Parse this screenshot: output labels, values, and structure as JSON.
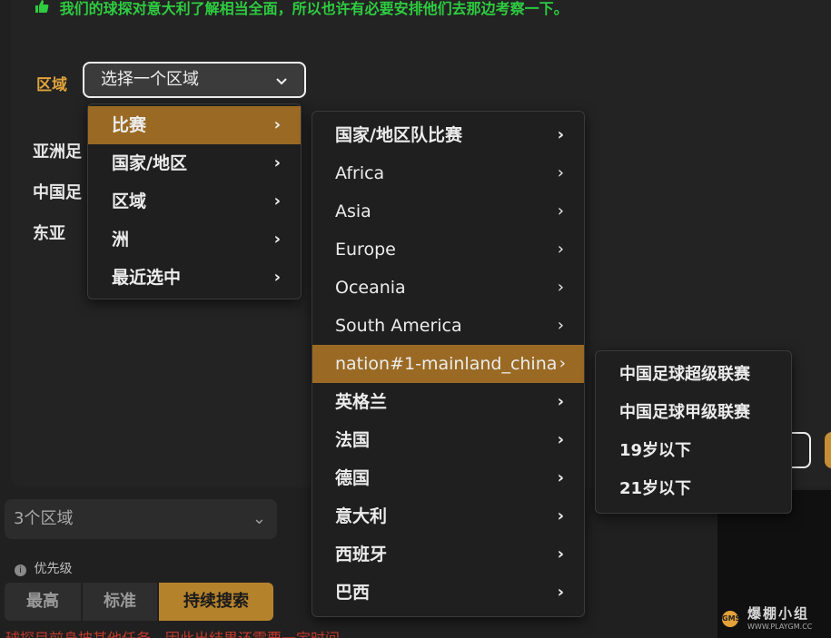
{
  "tip": {
    "icon": "thumbs-up-icon",
    "text": "我们的球探对意大利了解相当全面，所以也许有必要安排他们去那边考察一下。"
  },
  "region": {
    "label": "区域",
    "placeholder": "选择一个区域",
    "selected_items": [
      "亚洲足",
      "中国足",
      "东亚"
    ]
  },
  "menu_level1": [
    {
      "label": "比赛",
      "active": true
    },
    {
      "label": "国家/地区",
      "active": false
    },
    {
      "label": "区域",
      "active": false
    },
    {
      "label": "洲",
      "active": false
    },
    {
      "label": "最近选中",
      "active": false
    }
  ],
  "menu_level2": [
    {
      "label": "国家/地区队比赛",
      "active": false
    },
    {
      "label": "Africa",
      "active": false
    },
    {
      "label": "Asia",
      "active": false
    },
    {
      "label": "Europe",
      "active": false
    },
    {
      "label": "Oceania",
      "active": false
    },
    {
      "label": "South America",
      "active": false
    },
    {
      "label": "nation#1-mainland_china",
      "active": true
    },
    {
      "label": "英格兰",
      "active": false
    },
    {
      "label": "法国",
      "active": false
    },
    {
      "label": "德国",
      "active": false
    },
    {
      "label": "意大利",
      "active": false
    },
    {
      "label": "西班牙",
      "active": false
    },
    {
      "label": "巴西",
      "active": false
    }
  ],
  "menu_level3": [
    {
      "label": "中国足球超级联赛"
    },
    {
      "label": "中国足球甲级联赛"
    },
    {
      "label": "19岁以下"
    },
    {
      "label": "21岁以下"
    }
  ],
  "background": {
    "region_count": "3个区域",
    "priority_label": "优先级",
    "priority_options": [
      "最高",
      "标准",
      "持续搜索"
    ],
    "bottom_warning": "球探目前身披其他任务，因此出结果还需要一定时间。",
    "watermark_title": "爆棚小组",
    "watermark_url": "WWW.PLAYGM.CC"
  },
  "colors": {
    "accent": "#c68e34",
    "active_menu": "#9a6a24",
    "tip_text": "#2ecc40",
    "region_label": "#e0a33a"
  }
}
